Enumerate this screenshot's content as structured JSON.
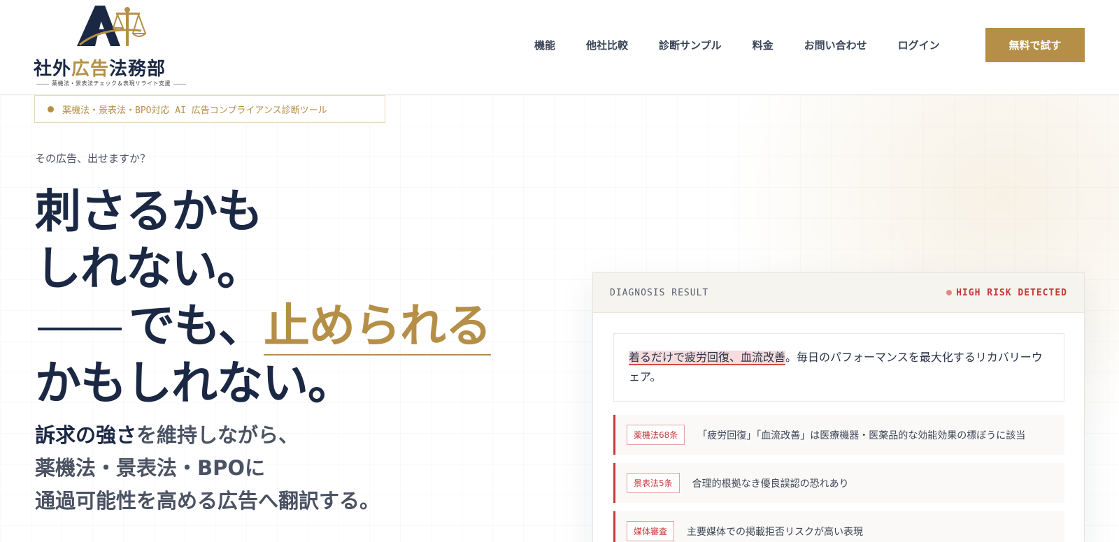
{
  "brand": {
    "mark_letters": "AI",
    "name_part1": "社外",
    "name_part2": "広告",
    "name_part3": "法務部",
    "tagline": "薬機法・景表法チェック＆表現リライト支援"
  },
  "nav": {
    "items": [
      {
        "label": "機能"
      },
      {
        "label": "他社比較"
      },
      {
        "label": "診断サンプル"
      },
      {
        "label": "料金"
      },
      {
        "label": "お問い合わせ"
      },
      {
        "label": "ログイン"
      }
    ],
    "cta_label": "無料で試す"
  },
  "hero": {
    "badge": "薬機法・景表法・BPO対応 AI 広告コンプライアンス診断ツール",
    "eyebrow": "その広告、出せますか？",
    "headline_line1": "刺さるかも",
    "headline_line2": "しれない。",
    "headline_line3_pre": "でも、",
    "headline_line3_accent": "止められる",
    "headline_line4": "かもしれない。",
    "sub_line1_strong": "訴求の強さ",
    "sub_line1_rest": "を維持しながら、",
    "sub_line2": "薬機法・景表法・BPOに",
    "sub_line3": "通過可能性を高める広告へ翻訳する。"
  },
  "diagnosis": {
    "title": "DIAGNOSIS RESULT",
    "risk_label": "HIGH RISK DETECTED",
    "ad_highlight": "着るだけで疲労回復、血流改善",
    "ad_rest": "。毎日のパフォーマンスを最大化するリカバリーウェア。",
    "issues": [
      {
        "tag": "薬機法68条",
        "text": "「疲労回復」「血流改善」は医療機器・医薬品的な効能効果の標ぼうに該当"
      },
      {
        "tag": "景表法5条",
        "text": "合理的根拠なき優良誤認の恐れあり"
      },
      {
        "tag": "媒体審査",
        "text": "主要媒体での掲載拒否リスクが高い表現"
      }
    ]
  },
  "colors": {
    "navy": "#1b2844",
    "gold": "#b58f47",
    "risk_red": "#c43a3a"
  }
}
